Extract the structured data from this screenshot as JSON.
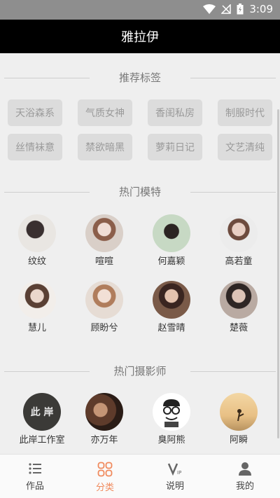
{
  "status": {
    "time": "3:09"
  },
  "app": {
    "title": "雅拉伊"
  },
  "sections": {
    "tags_title": "推荐标签",
    "models_title": "热门模特",
    "photographers_title": "热门摄影师"
  },
  "tags": [
    "天浴森系",
    "气质女神",
    "香闺私房",
    "制服时代",
    "丝情袜意",
    "禁欲暗黑",
    "萝莉日记",
    "文艺清纯"
  ],
  "models": [
    {
      "name": "纹纹"
    },
    {
      "name": "喧喧"
    },
    {
      "name": "何嘉颖"
    },
    {
      "name": "高若童"
    },
    {
      "name": "慧儿"
    },
    {
      "name": "顾盼兮"
    },
    {
      "name": "赵雪晴"
    },
    {
      "name": "楚薇"
    }
  ],
  "photographers": [
    {
      "name": "此岸工作室",
      "logo_text": "此 岸"
    },
    {
      "name": "亦万年"
    },
    {
      "name": "臭阿熊"
    },
    {
      "name": "阿瞬"
    }
  ],
  "tabs": [
    {
      "label": "作品",
      "icon": "list-icon",
      "active": false
    },
    {
      "label": "分类",
      "icon": "grid-icon",
      "active": true
    },
    {
      "label": "说明",
      "icon": "vip-icon",
      "active": false
    },
    {
      "label": "我的",
      "icon": "person-icon",
      "active": false
    }
  ],
  "colors": {
    "accent": "#f08a5d",
    "app_bar": "#000000",
    "status_bar": "#8e8e8e"
  }
}
